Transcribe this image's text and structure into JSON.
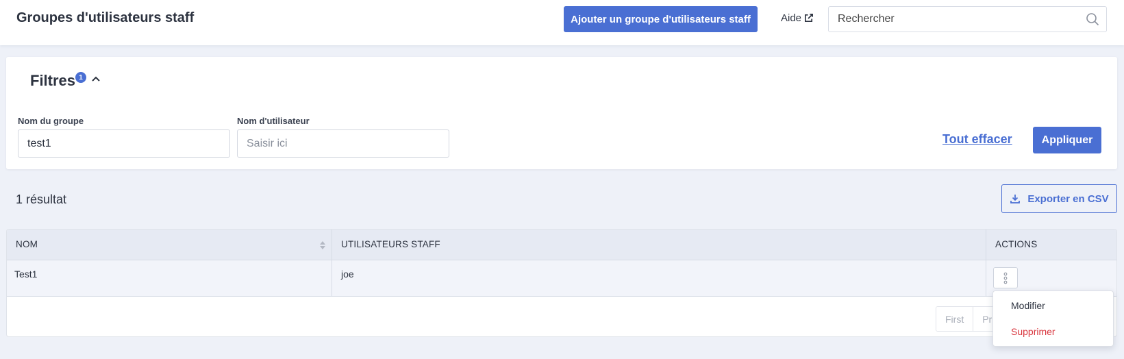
{
  "header": {
    "title": "Groupes d'utilisateurs staff",
    "add_button": "Ajouter un groupe d'utilisateurs staff",
    "help_label": "Aide",
    "help_icon": "external-link-icon",
    "search_placeholder": "Rechercher",
    "search_icon": "search-icon"
  },
  "filters": {
    "title": "Filtres",
    "active_count": "1",
    "toggle_icon": "chevron-up-icon",
    "group_name": {
      "label": "Nom du groupe",
      "value": "test1"
    },
    "username": {
      "label": "Nom d'utilisateur",
      "placeholder": "Saisir ici",
      "value": ""
    },
    "clear_label": "Tout effacer",
    "apply_label": "Appliquer"
  },
  "results": {
    "count_label": "1 résultat",
    "export_label": "Exporter en CSV",
    "export_icon": "download-icon"
  },
  "table": {
    "columns": [
      "NOM",
      "UTILISATEURS STAFF",
      "ACTIONS"
    ],
    "rows": [
      {
        "name": "Test1",
        "staff_users": "joe"
      }
    ],
    "pagination": [
      "First",
      "Pr"
    ]
  },
  "row_menu": {
    "edit_label": "Modifier",
    "delete_label": "Supprimer"
  },
  "colors": {
    "primary": "#4a6fd3",
    "danger": "#d9363e",
    "background": "#eef1f8",
    "table_header": "#e6eaf3"
  }
}
